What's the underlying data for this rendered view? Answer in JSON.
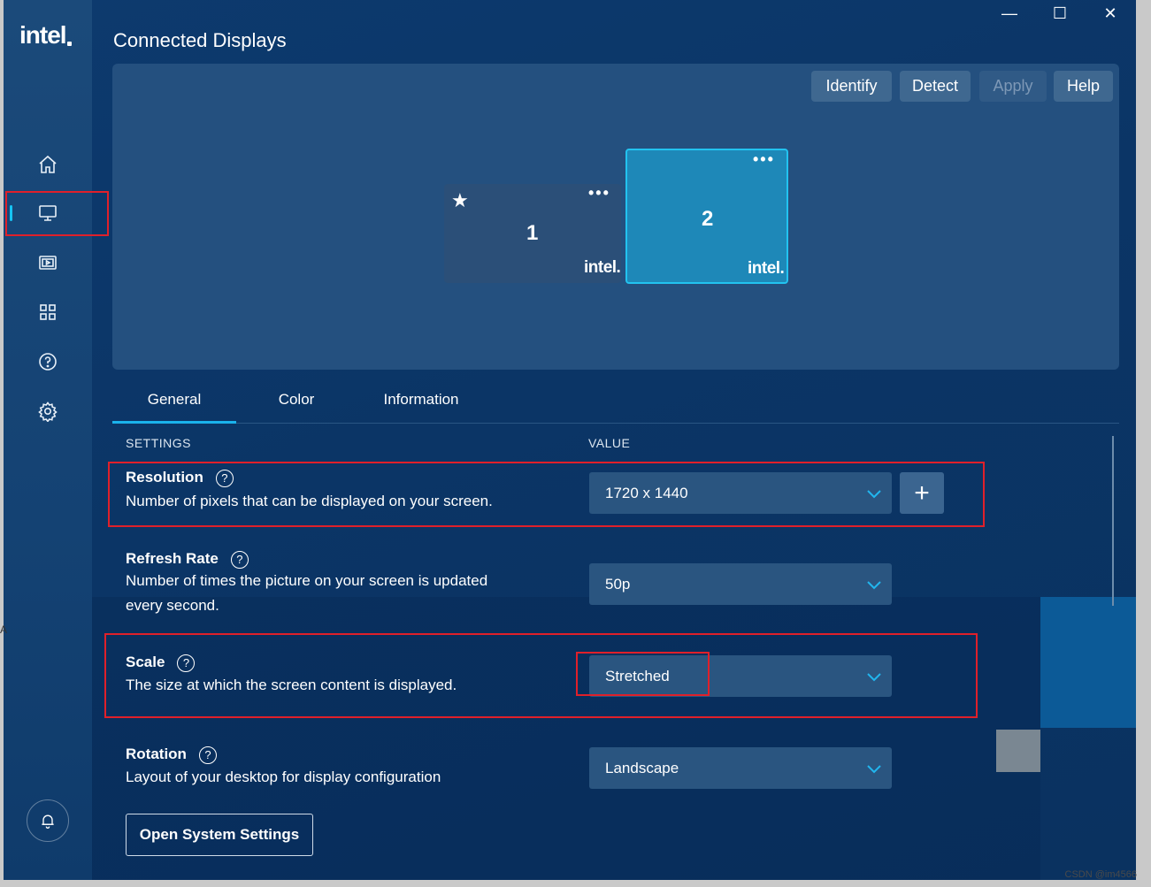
{
  "brand": {
    "logo": "intel"
  },
  "window": {
    "minimize": "—",
    "maximize": "☐",
    "close": "✕"
  },
  "page": {
    "title": "Connected Displays"
  },
  "toolbar": {
    "identify": "Identify",
    "detect": "Detect",
    "apply": "Apply",
    "help": "Help"
  },
  "displays": [
    {
      "number": "1",
      "primary": true,
      "menu": "•••",
      "logo": "intel."
    },
    {
      "number": "2",
      "primary": false,
      "selected": true,
      "menu": "•••",
      "logo": "intel."
    }
  ],
  "tabs": [
    {
      "label": "General",
      "active": true
    },
    {
      "label": "Color",
      "active": false
    },
    {
      "label": "Information",
      "active": false
    }
  ],
  "table_headers": {
    "settings": "SETTINGS",
    "value": "VALUE"
  },
  "settings": {
    "resolution": {
      "title": "Resolution",
      "desc": "Number of pixels that can be displayed on your screen.",
      "value": "1720 x 1440",
      "add": "+"
    },
    "refresh": {
      "title": "Refresh Rate",
      "desc": "Number of times the picture on your screen is updated every second.",
      "value": "50p"
    },
    "scale": {
      "title": "Scale",
      "desc": "The size at which the screen content is displayed.",
      "value": "Stretched"
    },
    "rotation": {
      "title": "Rotation",
      "desc": "Layout of your desktop for display configuration",
      "value": "Landscape"
    }
  },
  "help_glyph": "?",
  "open_system_settings": "Open System Settings",
  "watermark": "CSDN @im4566",
  "left_edge_glyph": "A",
  "colors": {
    "accent": "#1ab3ec",
    "highlight_box": "#e0202a",
    "background": "#0b3566"
  }
}
